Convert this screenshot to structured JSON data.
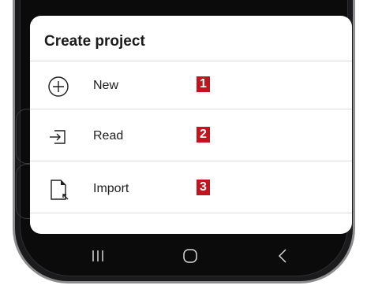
{
  "sheet": {
    "title": "Create project",
    "items": [
      {
        "label": "New",
        "badge": "1",
        "icon": "plus-circle-icon"
      },
      {
        "label": "Read",
        "badge": "2",
        "icon": "sign-in-icon"
      },
      {
        "label": "Import",
        "badge": "3",
        "icon": "import-file-icon"
      }
    ]
  },
  "navbar": {
    "buttons": [
      {
        "icon": "recent-apps-icon"
      },
      {
        "icon": "home-icon"
      },
      {
        "icon": "back-icon"
      }
    ]
  },
  "colors": {
    "badge": "#c0141e",
    "sheet_bg": "#ffffff",
    "phone_bg": "#1b1b1d"
  }
}
